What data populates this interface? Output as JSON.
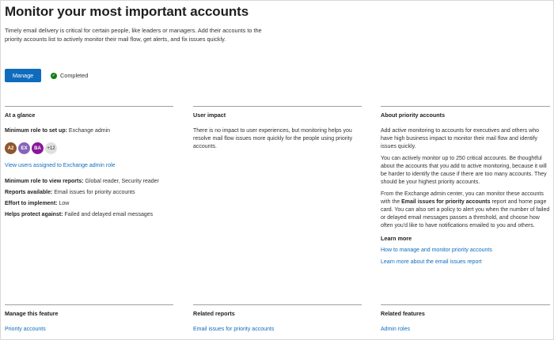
{
  "page": {
    "title": "Monitor your most important accounts",
    "intro": "Timely email delivery is critical for certain people, like leaders or managers. Add their accounts to the priority accounts list to actively monitor their mail flow, get alerts, and fix issues quickly.",
    "manage_label": "Manage",
    "status_label": "Completed"
  },
  "at_a_glance": {
    "heading": "At a glance",
    "min_role_setup_label": "Minimum role to set up:",
    "min_role_setup_value": " Exchange admin",
    "avatars": [
      {
        "initials": "A2",
        "color": "#8e562e"
      },
      {
        "initials": "EX",
        "color": "#8764b8"
      },
      {
        "initials": "BA",
        "color": "#881798"
      }
    ],
    "avatar_more": "+12",
    "view_users_link": "View users assigned to Exchange admin role",
    "min_role_reports_label": "Minimum role to view reports:",
    "min_role_reports_value": " Global reader, Security reader",
    "reports_label": "Reports available:",
    "reports_value": " Email issues for priority accounts",
    "effort_label": "Effort to implement:",
    "effort_value": " Low",
    "protects_label": "Helps protect against:",
    "protects_value": " Failed and delayed email messages"
  },
  "user_impact": {
    "heading": "User impact",
    "text": "There is no impact to user experiences, but monitoring helps you resolve mail flow issues more quickly for the people using priority accounts."
  },
  "about": {
    "heading": "About priority accounts",
    "p1": "Add active monitoring to accounts for executives and others who have high business impact to monitor their mail flow and identify issues quickly.",
    "p2": "You can actively monitor up to 250 critical accounts. Be thoughtful about the accounts that you add to active monitoring, because it will be harder to identify the cause if there are too many accounts. They should be your highest priority accounts.",
    "p3_pre": "From the Exchange admin center, you can monitor these accounts with the ",
    "p3_bold": "Email issues for priority accounts",
    "p3_post": " report and home page card. You can also set a policy to alert you when the number of failed or delayed email messages passes a threshold, and choose how often you'd like to have notifications emailed to you and others.",
    "learn_more": "Learn more",
    "link1": "How to manage and monitor priority accounts",
    "link2": "Learn more about the email issues report"
  },
  "manage_feature": {
    "heading": "Manage this feature",
    "link": "Priority accounts"
  },
  "related_reports": {
    "heading": "Related reports",
    "link": "Email issues for priority accounts"
  },
  "related_features": {
    "heading": "Related features",
    "link": "Admin roles"
  }
}
